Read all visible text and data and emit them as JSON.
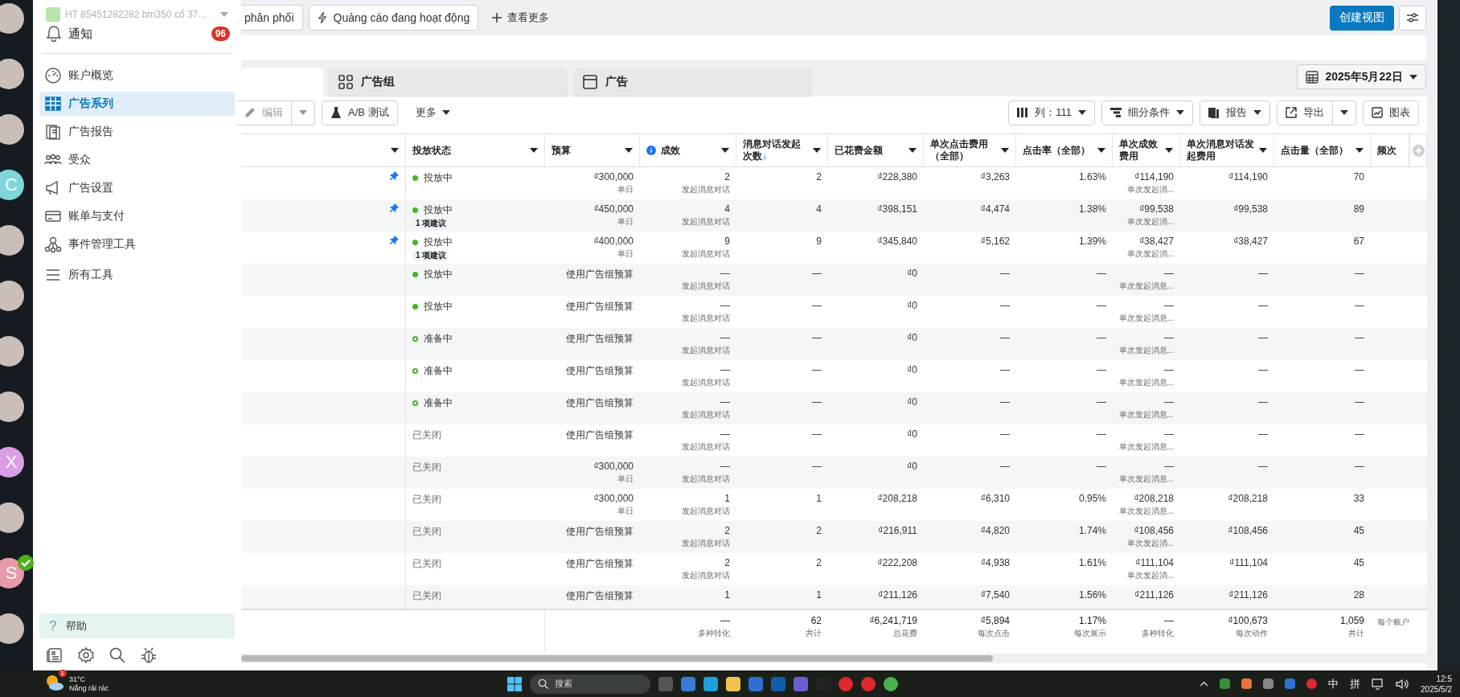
{
  "rail": {
    "avatars": [
      {
        "kind": "photo",
        "verified": false
      },
      {
        "kind": "photo",
        "verified": false
      },
      {
        "kind": "photo",
        "verified": false
      },
      {
        "kind": "letter",
        "letter": "C",
        "color": "#7fd6da",
        "verified": false
      },
      {
        "kind": "photo",
        "verified": false
      },
      {
        "kind": "photo",
        "verified": false
      },
      {
        "kind": "photo",
        "verified": false
      },
      {
        "kind": "photo",
        "verified": false
      },
      {
        "kind": "letter",
        "letter": "X",
        "color": "#d99ee6",
        "verified": false
      },
      {
        "kind": "photo",
        "verified": false
      },
      {
        "kind": "letter",
        "letter": "S",
        "color": "#e79aa8",
        "verified": true
      },
      {
        "kind": "photo",
        "verified": false
      }
    ]
  },
  "sidebar": {
    "account": "HT 85451282282 bm350 cổ 37...",
    "notifications": {
      "label": "通知",
      "count": "96"
    },
    "items": [
      {
        "label": "账户概览",
        "selected": false
      },
      {
        "label": "广告系列",
        "selected": true
      },
      {
        "label": "广告报告",
        "selected": false
      },
      {
        "label": "受众",
        "selected": false
      },
      {
        "label": "广告设置",
        "selected": false
      },
      {
        "label": "账单与支付",
        "selected": false
      },
      {
        "label": "事件管理工具",
        "selected": false
      },
      {
        "label": "所有工具",
        "selected": false
      }
    ],
    "help": "帮助",
    "help_mark": "?"
  },
  "topbar": {
    "chips": [
      {
        "label": "phân phối"
      },
      {
        "label": "Quảng cáo đang hoạt động"
      }
    ],
    "more": "查看更多",
    "create": "创建视图"
  },
  "tabs": [
    {
      "selected": true
    },
    {
      "label": "广告组",
      "selected": false
    },
    {
      "label": "广告",
      "selected": false
    }
  ],
  "date": "2025年5月22日",
  "toolbar": {
    "edit": "编辑",
    "edit_disabled": true,
    "ab": "A/B 测试",
    "more": "更多",
    "columns": "列：111",
    "breakdown": "细分条件",
    "reports": "报告",
    "export": "导出",
    "charts": "图表"
  },
  "table": {
    "columns": [
      {
        "caret": true
      },
      {
        "label": "投放状态",
        "caret": true
      },
      {
        "label": "预算",
        "caret": true
      },
      {
        "label": "成效",
        "caret": true,
        "info": true
      },
      {
        "label": "消息对话发起次数",
        "sort_mark": "↓",
        "caret": true
      },
      {
        "label": "已花费金额",
        "caret": true
      },
      {
        "label": "单次点击费用（全部）",
        "caret": true
      },
      {
        "label": "点击率（全部）",
        "caret": true
      },
      {
        "label": "单次成效费用",
        "caret": true
      },
      {
        "label": "单次消息对话发起费用",
        "caret": true
      },
      {
        "label": "点击量（全部）",
        "caret": true
      },
      {
        "label": "频次",
        "caret": false
      },
      {
        "kind": "add"
      }
    ],
    "rows": [
      {
        "pinned": true,
        "kind": "active",
        "status_text": "投放中",
        "budget": "₫300,000",
        "budget_sub": "单日",
        "results": "2",
        "results_sub": "发起消息对话",
        "msgs": "2",
        "spent": "₫228,380",
        "cpc": "₫3,263",
        "ctr": "1.63%",
        "cpr": "₫114,190",
        "cpr_sub": "单次发起消...",
        "cpm": "₫114,190",
        "clicks": "70"
      },
      {
        "pinned": true,
        "kind": "active",
        "status_text": "投放中",
        "suggestion": "1 项建议",
        "budget": "₫450,000",
        "budget_sub": "单日",
        "results": "4",
        "results_sub": "发起消息对话",
        "msgs": "4",
        "spent": "₫398,151",
        "cpc": "₫4,474",
        "ctr": "1.38%",
        "cpr": "₫99,538",
        "cpr_sub": "单次发起消...",
        "cpm": "₫99,538",
        "clicks": "89"
      },
      {
        "pinned": true,
        "kind": "active",
        "status_text": "投放中",
        "suggestion": "1 项建议",
        "budget": "₫400,000",
        "budget_sub": "单日",
        "results": "9",
        "results_sub": "发起消息对话",
        "msgs": "9",
        "spent": "₫345,840",
        "cpc": "₫5,162",
        "ctr": "1.39%",
        "cpr": "₫38,427",
        "cpr_sub": "单次发起消...",
        "cpm": "₫38,427",
        "clicks": "67"
      },
      {
        "pinned": false,
        "kind": "active",
        "status_text": "投放中",
        "budget": "使用广告组预算",
        "results": "—",
        "results_sub": "发起消息对话",
        "msgs": "—",
        "spent": "₫0",
        "cpc": "—",
        "ctr": "—",
        "cpr": "—",
        "cpr_sub": "单次发起消息...",
        "cpm": "—",
        "clicks": "—"
      },
      {
        "pinned": false,
        "kind": "active",
        "status_text": "投放中",
        "budget": "使用广告组预算",
        "results": "—",
        "results_sub": "发起消息对话",
        "msgs": "—",
        "spent": "₫0",
        "cpc": "—",
        "ctr": "—",
        "cpr": "—",
        "cpr_sub": "单次发起消息...",
        "cpm": "—",
        "clicks": "—"
      },
      {
        "pinned": false,
        "kind": "pending",
        "status_text": "准备中",
        "budget": "使用广告组预算",
        "results": "—",
        "results_sub": "发起消息对话",
        "msgs": "—",
        "spent": "₫0",
        "cpc": "—",
        "ctr": "—",
        "cpr": "—",
        "cpr_sub": "单次发起消息...",
        "cpm": "—",
        "clicks": "—"
      },
      {
        "pinned": false,
        "kind": "pending",
        "status_text": "准备中",
        "budget": "使用广告组预算",
        "results": "—",
        "results_sub": "发起消息对话",
        "msgs": "—",
        "spent": "₫0",
        "cpc": "—",
        "ctr": "—",
        "cpr": "—",
        "cpr_sub": "单次发起消息...",
        "cpm": "—",
        "clicks": "—"
      },
      {
        "pinned": false,
        "kind": "pending",
        "status_text": "准备中",
        "budget": "使用广告组预算",
        "results": "—",
        "results_sub": "发起消息对话",
        "msgs": "—",
        "spent": "₫0",
        "cpc": "—",
        "ctr": "—",
        "cpr": "—",
        "cpr_sub": "单次发起消息...",
        "cpm": "—",
        "clicks": "—"
      },
      {
        "pinned": false,
        "kind": "off",
        "status_text": "已关闭",
        "budget": "使用广告组预算",
        "results": "—",
        "results_sub": "发起消息对话",
        "msgs": "—",
        "spent": "₫0",
        "cpc": "—",
        "ctr": "—",
        "cpr": "—",
        "cpr_sub": "单次发起消息...",
        "cpm": "—",
        "clicks": "—"
      },
      {
        "pinned": false,
        "kind": "off",
        "status_text": "已关闭",
        "budget": "₫300,000",
        "budget_sub": "单日",
        "results": "—",
        "results_sub": "发起消息对话",
        "msgs": "—",
        "spent": "₫0",
        "cpc": "—",
        "ctr": "—",
        "cpr": "—",
        "cpr_sub": "单次发起消息...",
        "cpm": "—",
        "clicks": "—"
      },
      {
        "pinned": false,
        "kind": "off",
        "status_text": "已关闭",
        "budget": "₫300,000",
        "budget_sub": "单日",
        "results": "1",
        "results_sub": "发起消息对话",
        "msgs": "1",
        "spent": "₫208,218",
        "cpc": "₫6,310",
        "ctr": "0.95%",
        "cpr": "₫208,218",
        "cpr_sub": "单次发起消息...",
        "cpm": "₫208,218",
        "clicks": "33"
      },
      {
        "pinned": false,
        "kind": "off",
        "status_text": "已关闭",
        "budget": "使用广告组预算",
        "results": "2",
        "results_sub": "发起消息对话",
        "msgs": "2",
        "spent": "₫216,911",
        "cpc": "₫4,820",
        "ctr": "1.74%",
        "cpr": "₫108,456",
        "cpr_sub": "单次发起消...",
        "cpm": "₫108,456",
        "clicks": "45"
      },
      {
        "pinned": false,
        "kind": "off",
        "status_text": "已关闭",
        "budget": "使用广告组预算",
        "results": "2",
        "results_sub": "发起消息对话",
        "msgs": "2",
        "spent": "₫222,208",
        "cpc": "₫4,938",
        "ctr": "1.61%",
        "cpr": "₫111,104",
        "cpr_sub": "单次发起消...",
        "cpm": "₫111,104",
        "clicks": "45"
      },
      {
        "pinned": false,
        "kind": "off",
        "status_text": "已关闭",
        "budget": "使用广告组预算",
        "results": "1",
        "msgs": "1",
        "spent": "₫211,126",
        "cpc": "₫7,540",
        "ctr": "1.56%",
        "cpr": "₫211,126",
        "cpm": "₫211,126",
        "clicks": "28"
      }
    ],
    "totals": {
      "results": {
        "value": "—",
        "sub": "多种转化"
      },
      "msgs": {
        "value": "62",
        "sub": "共计"
      },
      "spent": {
        "value": "₫6,241,719",
        "sub": "总花费"
      },
      "cpc": {
        "value": "₫5,894",
        "sub": "每次点击"
      },
      "ctr": {
        "value": "1.17%",
        "sub": "每次展示"
      },
      "cpr": {
        "value": "—",
        "sub": "多种转化"
      },
      "cpm": {
        "value": "₫100,673",
        "sub": "每次动作"
      },
      "clicks": {
        "value": "1,059",
        "sub": "共计"
      },
      "frequency": {
        "sub": "每个账户"
      }
    }
  },
  "taskbar": {
    "weather": {
      "temp": "31°C",
      "desc": "Nắng rải rác",
      "alerts": "1"
    },
    "search": "搜索",
    "ime": [
      "中",
      "拼"
    ],
    "time": "12:5",
    "date": "2025/5/2"
  }
}
